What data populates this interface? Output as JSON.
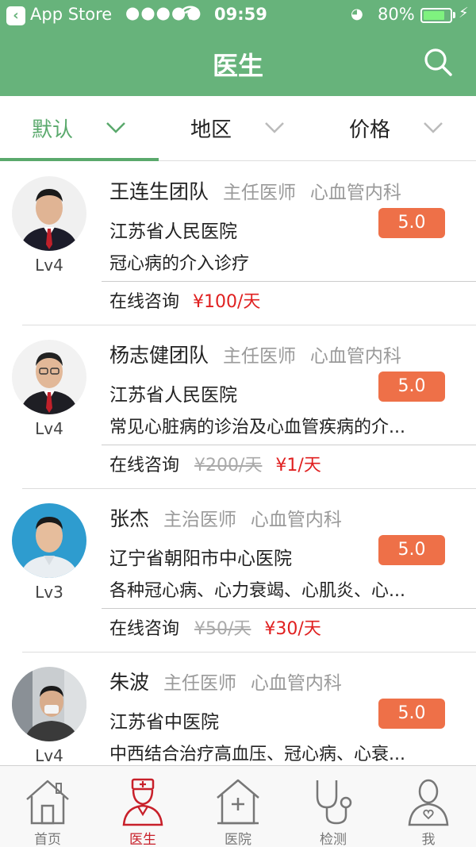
{
  "status_bar": {
    "back_app": "App Store",
    "signal": "●●●●●",
    "time": "09:59",
    "battery_pct": "80%",
    "battery_level": 0.8
  },
  "header": {
    "title": "医生"
  },
  "filters": [
    {
      "label": "默认",
      "active": true
    },
    {
      "label": "地区",
      "active": false
    },
    {
      "label": "价格",
      "active": false
    }
  ],
  "doctors": [
    {
      "name": "王连生团队",
      "title": "主任医师",
      "dept": "心血管内科",
      "hospital": "江苏省人民医院",
      "rating": "5.0",
      "specialty": "冠心病的介入诊疗",
      "level": "Lv4",
      "consult_label": "在线咨询",
      "old_price": "",
      "price": "¥100/天"
    },
    {
      "name": "杨志健团队",
      "title": "主任医师",
      "dept": "心血管内科",
      "hospital": "江苏省人民医院",
      "rating": "5.0",
      "specialty": "常见心脏病的诊治及心血管疾病的介...",
      "level": "Lv4",
      "consult_label": "在线咨询",
      "old_price": "¥200/天",
      "price": "¥1/天"
    },
    {
      "name": "张杰",
      "title": "主治医师",
      "dept": "心血管内科",
      "hospital": "辽宁省朝阳市中心医院",
      "rating": "5.0",
      "specialty": "各种冠心病、心力衰竭、心肌炎、心...",
      "level": "Lv3",
      "consult_label": "在线咨询",
      "old_price": "¥50/天",
      "price": "¥30/天"
    },
    {
      "name": "朱波",
      "title": "主任医师",
      "dept": "心血管内科",
      "hospital": "江苏省中医院",
      "rating": "5.0",
      "specialty": "中西结合治疗高血压、冠心病、心衰...",
      "level": "Lv4",
      "consult_label": "",
      "old_price": "",
      "price": ""
    }
  ],
  "tabbar": [
    {
      "label": "首页",
      "icon": "home-icon",
      "active": false
    },
    {
      "label": "医生",
      "icon": "doctor-icon",
      "active": true
    },
    {
      "label": "医院",
      "icon": "hospital-icon",
      "active": false
    },
    {
      "label": "检测",
      "icon": "stethoscope-icon",
      "active": false
    },
    {
      "label": "我",
      "icon": "user-icon",
      "active": false
    }
  ],
  "colors": {
    "brand_green": "#67b37b",
    "active_green": "#5aa96c",
    "rating_orange": "#ee7048",
    "price_red": "#e02020",
    "tab_active_red": "#c8202a"
  }
}
